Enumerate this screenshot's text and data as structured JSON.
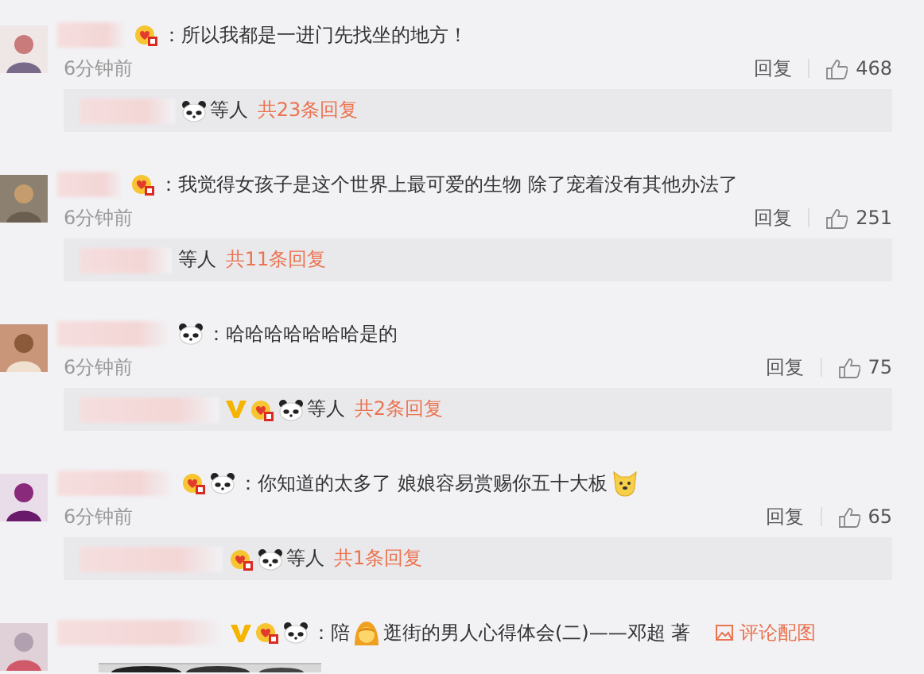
{
  "comments": [
    {
      "badges": [
        {
          "kind": "crown"
        }
      ],
      "parts": [
        {
          "kind": "text",
          "text": "：所以我都是一进门先找坐的地方！"
        }
      ],
      "time": "6分钟前",
      "reply": "回复",
      "likes": "468",
      "thread": {
        "badges": [
          {
            "kind": "panda"
          }
        ],
        "who": "等人",
        "count": "共23条回复"
      }
    },
    {
      "badges": [
        {
          "kind": "crown"
        }
      ],
      "parts": [
        {
          "kind": "text",
          "text": "：我觉得女孩子是这个世界上最可爱的生物 除了宠着没有其他办法了"
        }
      ],
      "time": "6分钟前",
      "reply": "回复",
      "likes": "251",
      "thread": {
        "who": "等人",
        "count": "共11条回复"
      }
    },
    {
      "badges": [
        {
          "kind": "panda"
        }
      ],
      "parts": [
        {
          "kind": "text",
          "text": "：哈哈哈哈哈哈哈是的"
        }
      ],
      "time": "6分钟前",
      "reply": "回复",
      "likes": "75",
      "thread": {
        "badges": [
          {
            "kind": "vip"
          },
          {
            "kind": "crown"
          },
          {
            "kind": "panda"
          }
        ],
        "who": "等人",
        "count": "共2条回复"
      }
    },
    {
      "badges": [
        {
          "kind": "crown"
        },
        {
          "kind": "panda"
        }
      ],
      "parts": [
        {
          "kind": "text",
          "text": "：你知道的太多了 娘娘容易赏赐你五十大板"
        },
        {
          "kind": "dog"
        }
      ],
      "time": "6分钟前",
      "reply": "回复",
      "likes": "65",
      "thread": {
        "badges": [
          {
            "kind": "crown"
          },
          {
            "kind": "panda"
          }
        ],
        "who": "等人",
        "count": "共1条回复"
      }
    },
    {
      "badges": [
        {
          "kind": "vip"
        },
        {
          "kind": "crown"
        },
        {
          "kind": "panda"
        }
      ],
      "parts": [
        {
          "kind": "text",
          "text": "：陪"
        },
        {
          "kind": "girl"
        },
        {
          "kind": "text",
          "text": "逛街的男人心得体会(二)——邓超 著"
        }
      ],
      "image_link": "评论配图"
    }
  ]
}
